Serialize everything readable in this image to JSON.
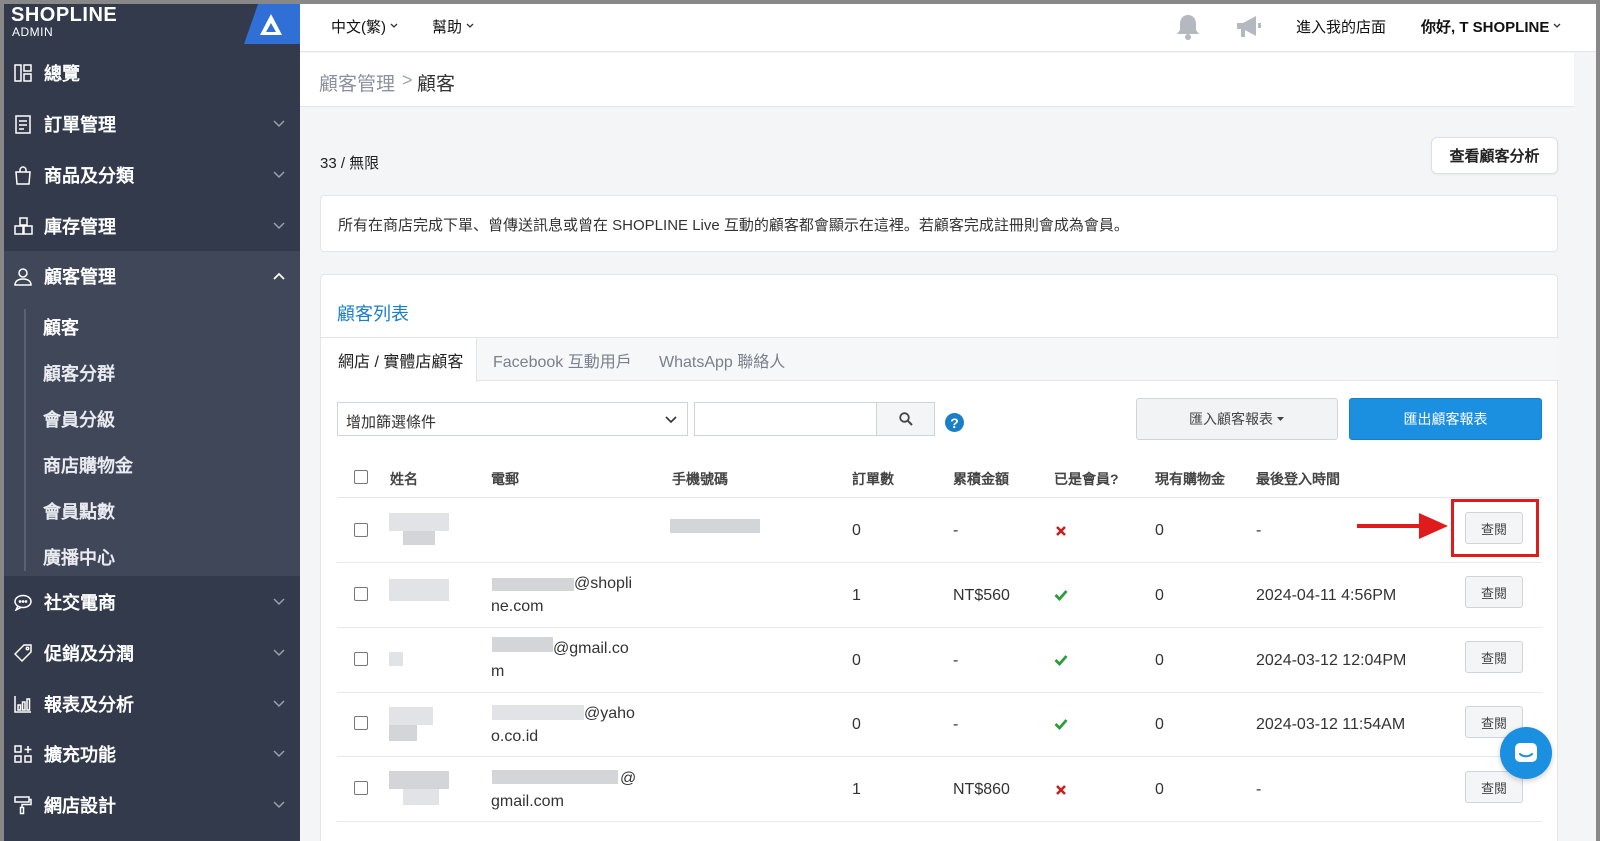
{
  "brand": {
    "logo_main": "SHOPLINE",
    "logo_sub": "ADMIN"
  },
  "sidebar": {
    "items": [
      {
        "label": "總覽",
        "icon": "dashboard-icon"
      },
      {
        "label": "訂單管理",
        "icon": "order-icon"
      },
      {
        "label": "商品及分類",
        "icon": "bag-icon"
      },
      {
        "label": "庫存管理",
        "icon": "inventory-icon"
      },
      {
        "label": "顧客管理",
        "icon": "user-icon",
        "active": true
      },
      {
        "label": "社交電商",
        "icon": "chat-bubble-icon"
      },
      {
        "label": "促銷及分潤",
        "icon": "tag-icon"
      },
      {
        "label": "報表及分析",
        "icon": "chart-icon"
      },
      {
        "label": "擴充功能",
        "icon": "apps-icon"
      },
      {
        "label": "網店設計",
        "icon": "paint-roller-icon"
      }
    ],
    "sub_items": [
      "顧客",
      "顧客分群",
      "會員分級",
      "商店購物金",
      "會員點數",
      "廣播中心"
    ]
  },
  "topbar": {
    "language": "中文(繁)",
    "help": "幫助",
    "visit_store": "進入我的店面",
    "greeting": "你好, T SHOPLINE"
  },
  "breadcrumb": {
    "parent": "顧客管理",
    "separator": ">",
    "current": "顧客"
  },
  "quota": "33 / 無限",
  "analysis_button": "查看顧客分析",
  "info_text": "所有在商店完成下單、曾傳送訊息或曾在 SHOPLINE Live 互動的顧客都會顯示在這裡。若顧客完成註冊則會成為會員。",
  "panel": {
    "title": "顧客列表",
    "tabs": [
      "網店 / 實體店顧客",
      "Facebook 互動用戶",
      "WhatsApp 聯絡人"
    ],
    "filter_placeholder": "增加篩選條件",
    "search_value": "",
    "import_label": "匯入顧客報表",
    "export_label": "匯出顧客報表"
  },
  "table": {
    "headers": [
      "姓名",
      "電郵",
      "手機號碼",
      "訂單數",
      "累積金額",
      "已是會員?",
      "現有購物金",
      "最後登入時間"
    ],
    "rows": [
      {
        "email_l1": "",
        "email_l2": "",
        "orders": "0",
        "amount": "-",
        "member": false,
        "credit": "0",
        "last_login": "-",
        "action": "查閱"
      },
      {
        "email_l1": "@shopli",
        "email_l2": "ne.com",
        "orders": "1",
        "amount": "NT$560",
        "member": true,
        "credit": "0",
        "last_login": "2024-04-11 4:56PM",
        "action": "查閱"
      },
      {
        "email_l1": "@gmail.co",
        "email_l2": "m",
        "orders": "0",
        "amount": "-",
        "member": true,
        "credit": "0",
        "last_login": "2024-03-12 12:04PM",
        "action": "查閱"
      },
      {
        "email_l1": "@yaho",
        "email_l2": "o.co.id",
        "orders": "0",
        "amount": "-",
        "member": true,
        "credit": "0",
        "last_login": "2024-03-12 11:54AM",
        "action": "查閱"
      },
      {
        "email_l1": "@",
        "email_l2": "gmail.com",
        "orders": "1",
        "amount": "NT$860",
        "member": false,
        "credit": "0",
        "last_login": "-",
        "action": "查閱"
      }
    ]
  },
  "colors": {
    "sidebar_bg": "#333a4b",
    "accent": "#1b8fe0",
    "highlight": "#e01b1b",
    "yes": "#2a9d3a",
    "no": "#c81e1e"
  }
}
